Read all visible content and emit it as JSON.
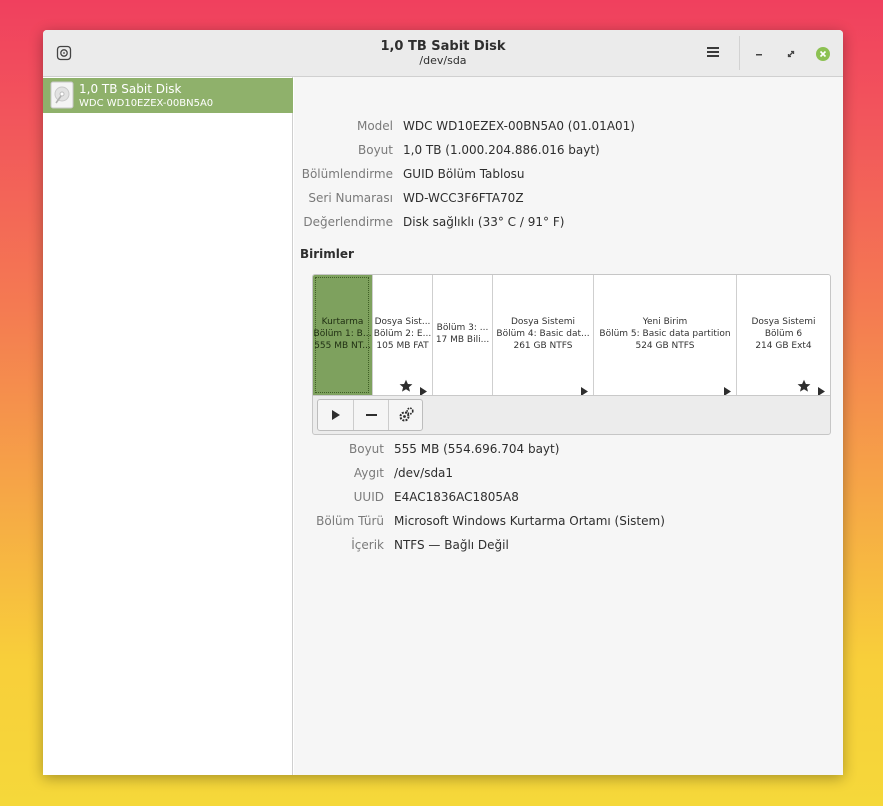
{
  "window": {
    "title": "1,0 TB Sabit Disk",
    "subtitle": "/dev/sda"
  },
  "sidebar": {
    "items": [
      {
        "title": "1,0 TB Sabit Disk",
        "subtitle": "WDC WD10EZEX-00BN5A0",
        "selected": true,
        "icon": "harddisk-icon"
      }
    ]
  },
  "disk_info": [
    {
      "label": "Model",
      "value": "WDC WD10EZEX-00BN5A0 (01.01A01)"
    },
    {
      "label": "Boyut",
      "value": "1,0 TB (1.000.204.886.016 bayt)"
    },
    {
      "label": "Bölümlendirme",
      "value": "GUID Bölüm Tablosu"
    },
    {
      "label": "Seri Numarası",
      "value": "WD-WCC3F6FTA70Z"
    },
    {
      "label": "Değerlendirme",
      "value": "Disk sağlıklı (33° C / 91° F)"
    }
  ],
  "volumes": {
    "title": "Birimler",
    "partitions": [
      {
        "line1": "Kurtarma",
        "line2": "Bölüm 1: B...",
        "line3": "555 MB NT...",
        "selected": true
      },
      {
        "line1": "Dosya Sist...",
        "line2": "Bölüm 2: E...",
        "line3": "105 MB FAT",
        "star": true,
        "arrow": true
      },
      {
        "line1": "",
        "line2": "Bölüm 3: ...",
        "line3": "17 MB Bili..."
      },
      {
        "line1": "Dosya Sistemi",
        "line2": "Bölüm 4: Basic dat...",
        "line3": "261 GB NTFS",
        "arrow": true
      },
      {
        "line1": "Yeni Birim",
        "line2": "Bölüm 5: Basic data partition",
        "line3": "524 GB NTFS",
        "arrow": true
      },
      {
        "line1": "Dosya Sistemi",
        "line2": "Bölüm 6",
        "line3": "214 GB Ext4",
        "star": true,
        "arrow": true
      }
    ],
    "tools": [
      "play-icon",
      "minus-icon",
      "gears-icon"
    ]
  },
  "partition_info": [
    {
      "label": "Boyut",
      "value": "555 MB (554.696.704 bayt)"
    },
    {
      "label": "Aygıt",
      "value": "/dev/sda1"
    },
    {
      "label": "UUID",
      "value": "E4AC1836AC1805A8"
    },
    {
      "label": "Bölüm Türü",
      "value": "Microsoft Windows Kurtarma Ortamı (Sistem)"
    },
    {
      "label": "İçerik",
      "value": "NTFS — Bağlı Değil"
    }
  ],
  "colors": {
    "accent": "#8fb16b",
    "selected_partition": "#7ea15e",
    "close_button": "#8cc152"
  }
}
